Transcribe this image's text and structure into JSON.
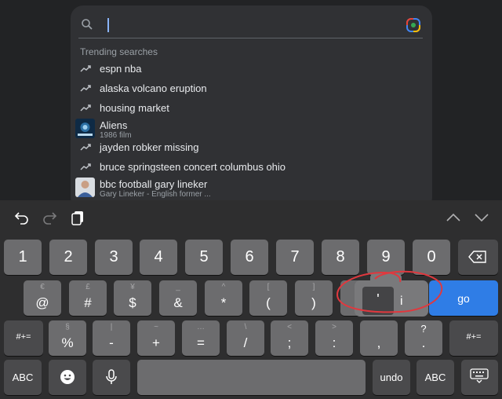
{
  "search": {
    "value": "",
    "placeholder": ""
  },
  "trending_label": "Trending searches",
  "suggestions": [
    {
      "kind": "trend",
      "text": "espn nba"
    },
    {
      "kind": "trend",
      "text": "alaska volcano eruption"
    },
    {
      "kind": "trend",
      "text": "housing market"
    },
    {
      "kind": "entity",
      "text": "Aliens",
      "sub": "1986 film"
    },
    {
      "kind": "trend",
      "text": "jayden robker missing"
    },
    {
      "kind": "trend",
      "text": "bruce springsteen concert columbus ohio"
    },
    {
      "kind": "entity",
      "text": "bbc football gary lineker",
      "sub": "Gary Lineker - English former ..."
    }
  ],
  "toolbar": {
    "icons": [
      "undo-icon",
      "redo-icon",
      "clipboard-icon",
      "chevron-up-icon",
      "chevron-down-icon"
    ]
  },
  "keys": {
    "row1": [
      "1",
      "2",
      "3",
      "4",
      "5",
      "6",
      "7",
      "8",
      "9",
      "0"
    ],
    "row2": [
      {
        "main": "@",
        "sec": "€"
      },
      {
        "main": "#",
        "sec": "£"
      },
      {
        "main": "$",
        "sec": "¥"
      },
      {
        "main": "&",
        "sec": "_"
      },
      {
        "main": "*",
        "sec": "^"
      },
      {
        "main": "(",
        "sec": "["
      },
      {
        "main": ")",
        "sec": "]"
      },
      {
        "main": "’",
        "sec": "{"
      }
    ],
    "row3": [
      {
        "main": "%",
        "sec": "§"
      },
      {
        "main": "-",
        "sec": "|"
      },
      {
        "main": "+",
        "sec": "~"
      },
      {
        "main": "=",
        "sec": "…"
      },
      {
        "main": "/",
        "sec": "\\"
      },
      {
        "main": ";",
        "sec": "<"
      },
      {
        "main": ":",
        "sec": ">"
      },
      {
        "main": ",",
        "sec": ""
      },
      {
        "main": ".",
        "sec": "?"
      }
    ],
    "go_label": "go",
    "symbols_label": "#+=",
    "abc_label": "ABC",
    "undo_label": "undo"
  },
  "popup": {
    "selected": "'",
    "alt": "i"
  },
  "colors": {
    "accent": "#2f7de6",
    "annotation": "#e0383e",
    "caret": "#8ab4f8"
  }
}
